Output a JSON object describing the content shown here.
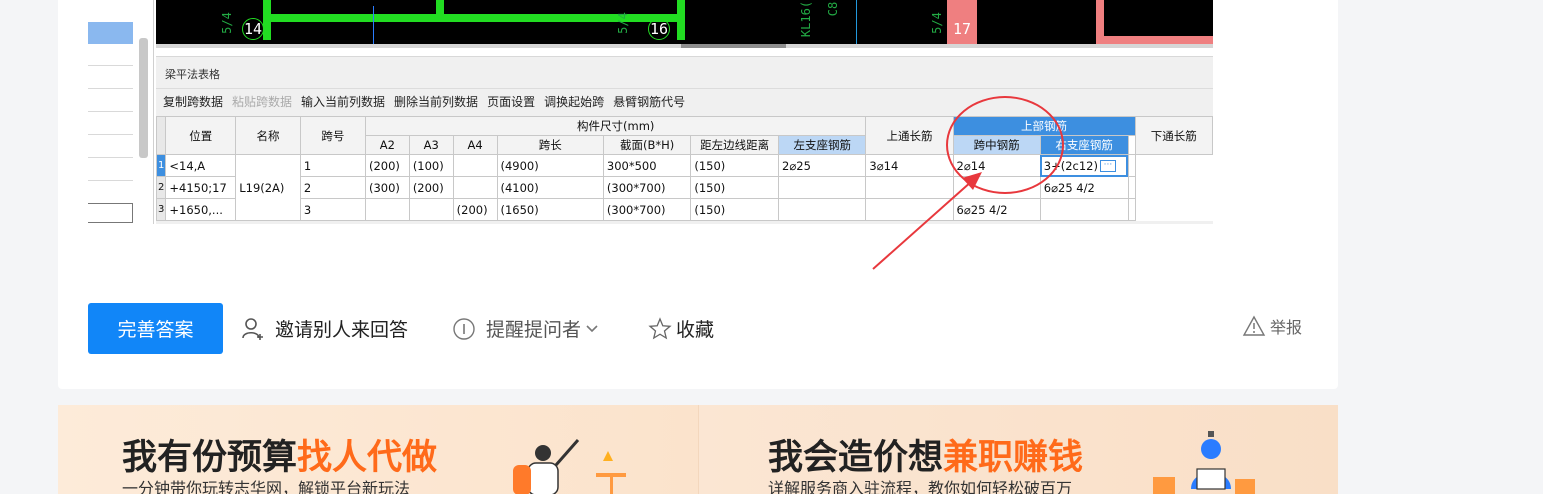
{
  "embedded_screenshot": {
    "cad_labels": [
      "5/4",
      "14",
      "5/4",
      "16",
      "KL16(",
      "C8",
      "5/4",
      "17"
    ],
    "panel_title": "梁平法表格",
    "toolbar": [
      "复制跨数据",
      "粘贴跨数据",
      "输入当前列数据",
      "删除当前列数据",
      "页面设置",
      "调换起始跨",
      "悬臂钢筋代号"
    ],
    "toolbar_disabled_index": 1,
    "table": {
      "group_headers": {
        "size": "构件尺寸(mm)",
        "top_rebar": "上部钢筋"
      },
      "headers": [
        "位置",
        "名称",
        "跨号",
        "A2",
        "A3",
        "A4",
        "跨长",
        "截面(B*H)",
        "距左边线距离",
        "上通长筋",
        "左支座钢筋",
        "跨中钢筋",
        "右支座钢筋",
        "下通长筋"
      ],
      "row_numbers": [
        "1",
        "2",
        "3"
      ],
      "position_lines": [
        "<14,A",
        "+4150;17",
        "+1650,..."
      ],
      "name": "L19(2A)",
      "rows": [
        {
          "span": "1",
          "a2": "(200)",
          "a3": "(100)",
          "a4": "",
          "len": "(4900)",
          "section": "300*500",
          "dist": "(150)",
          "top_through": "2⌀25",
          "left": "3⌀14",
          "mid": "2⌀14",
          "right": "3+(2c12)",
          "bottom": ""
        },
        {
          "span": "2",
          "a2": "(300)",
          "a3": "(200)",
          "a4": "",
          "len": "(4100)",
          "section": "(300*700)",
          "dist": "(150)",
          "top_through": "",
          "left": "",
          "mid": "",
          "right": "6⌀25 4/2",
          "bottom": ""
        },
        {
          "span": "3",
          "a2": "",
          "a3": "",
          "a4": "(200)",
          "len": "(1650)",
          "section": "(300*700)",
          "dist": "(150)",
          "top_through": "",
          "left": "",
          "mid": "6⌀25 4/2",
          "right": "",
          "bottom": ""
        }
      ]
    }
  },
  "actions": {
    "improve_answer": "完善答案",
    "invite": "邀请别人来回答",
    "remind": "提醒提问者",
    "favorite": "收藏",
    "report": "举报"
  },
  "banners": [
    {
      "title_prefix": "我有份预算",
      "title_highlight": "找人代做",
      "subtitle": "一分钟带你玩转志华网，解锁平台新玩法"
    },
    {
      "title_prefix": "我会造价想",
      "title_highlight": "兼职赚钱",
      "subtitle": "详解服务商入驻流程，教你如何轻松破百万"
    }
  ],
  "colors": {
    "primary": "#1186f8",
    "highlight": "#ff6a1a",
    "annotation": "#e8383d"
  }
}
